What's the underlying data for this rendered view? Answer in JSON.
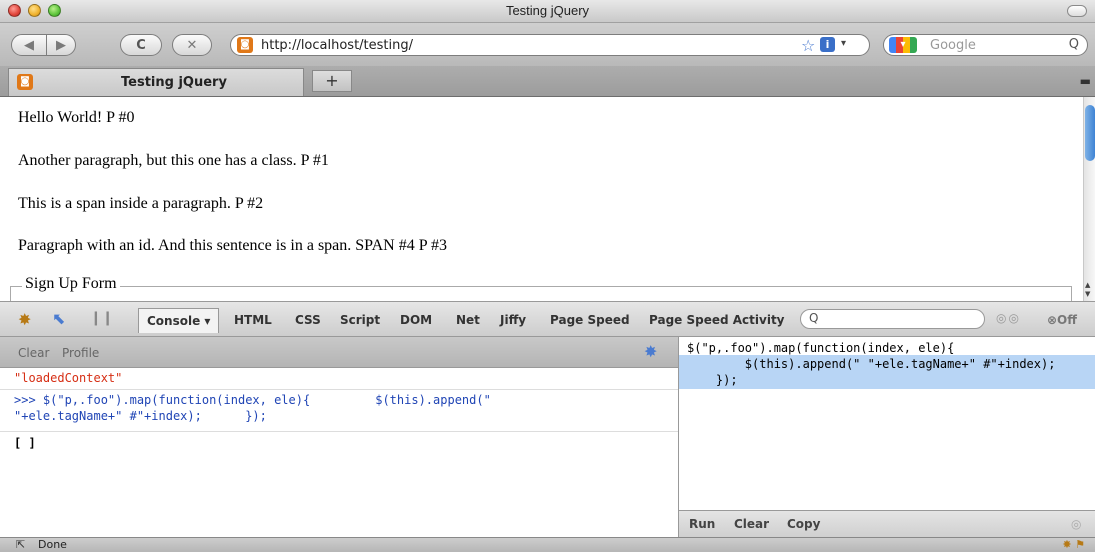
{
  "window": {
    "title": "Testing jQuery"
  },
  "navbar": {
    "back_icon": "◀",
    "forward_icon": "▶",
    "reload_icon": "C",
    "stop_icon": "✕",
    "url": "http://localhost/testing/",
    "star_icon": "☆",
    "info_icon": "i",
    "dropdown_icon": "▾",
    "search_placeholder": "Google",
    "search_icon": "Q"
  },
  "tabs": {
    "items": [
      {
        "label": "Testing jQuery"
      }
    ],
    "new_tab_icon": "+"
  },
  "page": {
    "paragraphs": [
      "Hello World! P #0",
      "Another paragraph, but this one has a class. P #1",
      "This is a span inside a paragraph. P #2",
      "Paragraph with an id. And this sentence is in a span. SPAN #4 P #3"
    ],
    "fieldset_legend": "Sign Up Form"
  },
  "firebug": {
    "tabs": [
      {
        "label": "Console ▾"
      },
      {
        "label": "HTML"
      },
      {
        "label": "CSS"
      },
      {
        "label": "Script"
      },
      {
        "label": "DOM"
      },
      {
        "label": "Net"
      },
      {
        "label": "Jiffy"
      },
      {
        "label": "Page Speed"
      },
      {
        "label": "Page Speed Activity"
      }
    ],
    "search_icon": "Q",
    "off_label": "⊗Off",
    "minmax_icons": "◎◎"
  },
  "console": {
    "clear_label": "Clear",
    "profile_label": "Profile",
    "log_entry": "\"loadedContext\"",
    "command_line1": ">>> $(\"p,.foo\").map(function(index, ele){         $(this).append(\"",
    "command_line2": "\"+ele.tagName+\" #\"+index);      });",
    "result": "[ ]"
  },
  "editor": {
    "lines": [
      "$(\"p,.foo\").map(function(index, ele){",
      "        $(this).append(\" \"+ele.tagName+\" #\"+index);",
      "    });"
    ],
    "run_label": "Run",
    "clear_label": "Clear",
    "copy_label": "Copy",
    "close_icon": "◎"
  },
  "status": {
    "text": "Done"
  },
  "colors": {
    "log_red": "#d62e14",
    "command_blue": "#2045b5",
    "selection": "#b8d5f5",
    "favicon_orange": "#e07818"
  }
}
